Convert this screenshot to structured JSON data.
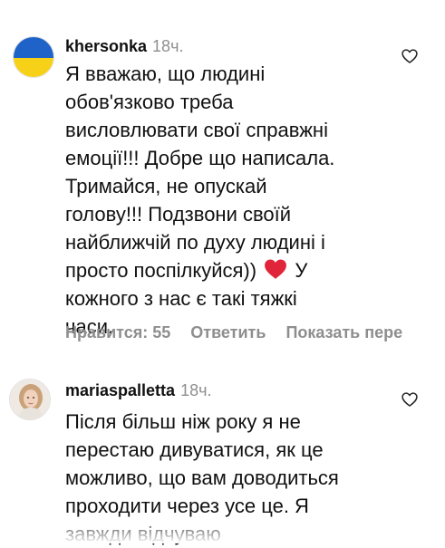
{
  "comments": [
    {
      "username": "khersonka",
      "time": "18ч.",
      "lines": [
        "Я вважаю, що людині",
        "обов'язково треба",
        "висловлювати свої справжні",
        "емоції!!! Добре що написала.",
        "Тримайся,  не опускай",
        "голову!!! Подзвони своїй",
        "найближчій по духу людині і",
        "просто поспілкуйся))",
        "У",
        "кожного з нас є такі тяжкі",
        "часи."
      ],
      "likes_label": "Нравится: 55",
      "reply_label": "Ответить",
      "translate_label": "Показать пере"
    },
    {
      "username": "mariaspalletta",
      "time": "18ч.",
      "lines": [
        "Після більш ніж року я не",
        "перестаю дивуватися, як це",
        "можливо, що вам доводиться",
        "проходити через усе це. Я",
        "завжди відчуваю"
      ]
    }
  ],
  "colors": {
    "flag_blue": "#1f63c9",
    "flag_yellow": "#f7d117",
    "heart_emoji": "#e0243a",
    "muted": "#8e8e8e"
  },
  "icons": [
    "heart-outline-icon",
    "red-heart-emoji"
  ]
}
